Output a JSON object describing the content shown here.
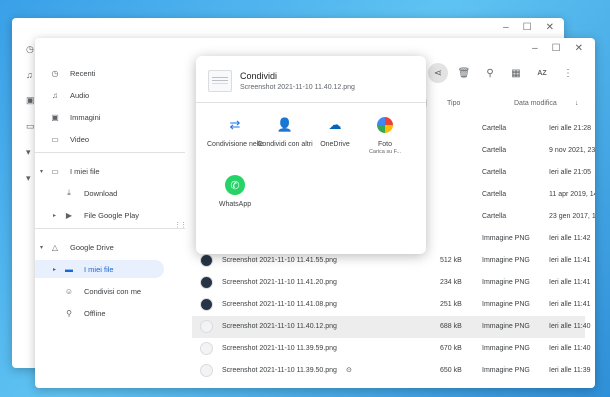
{
  "window_controls": {
    "minimize": "–",
    "maximize": "☐",
    "close": "✕"
  },
  "sidebar": {
    "items": [
      {
        "label": "Recenti",
        "icon": "clock-icon"
      },
      {
        "label": "Audio",
        "icon": "headphones-icon"
      },
      {
        "label": "Immagini",
        "icon": "image-icon"
      },
      {
        "label": "Video",
        "icon": "video-icon"
      },
      {
        "label": "I miei file",
        "icon": "laptop-icon"
      },
      {
        "label": "Download",
        "icon": "download-icon"
      },
      {
        "label": "File Google Play",
        "icon": "play-icon"
      },
      {
        "label": "Google Drive",
        "icon": "drive-icon"
      },
      {
        "label": "I miei file",
        "icon": "folder-icon"
      },
      {
        "label": "Condivisi con me",
        "icon": "people-icon"
      },
      {
        "label": "Offline",
        "icon": "pin-icon"
      }
    ]
  },
  "toolbar": {
    "sort_label": "AZ"
  },
  "columns": {
    "type": "Tipo",
    "date": "Data modifica"
  },
  "share_dialog": {
    "title": "Condividi",
    "file_name": "Screenshot 2021-11-10 11.40.12.png",
    "targets": [
      {
        "label": "Condivisione nelle ...",
        "sub": "",
        "icon": "nearby-share-icon"
      },
      {
        "label": "Condividi con altri",
        "sub": "",
        "icon": "add-person-icon"
      },
      {
        "label": "OneDrive",
        "sub": "",
        "icon": "cloud-icon"
      },
      {
        "label": "Foto",
        "sub": "Carica su F...",
        "icon": "photos-icon"
      },
      {
        "label": "WhatsApp",
        "sub": "",
        "icon": "whatsapp-icon"
      }
    ]
  },
  "files": [
    {
      "name": "",
      "size": "",
      "type": "Cartella",
      "date": "Ieri alle 21:28"
    },
    {
      "name": "",
      "size": "",
      "type": "Cartella",
      "date": "9 nov 2021, 23:08"
    },
    {
      "name": "",
      "size": "",
      "type": "Cartella",
      "date": "Ieri alle 21:05"
    },
    {
      "name": "",
      "size": "",
      "type": "Cartella",
      "date": "11 apr 2019, 14:57"
    },
    {
      "name": "",
      "size": "",
      "type": "Cartella",
      "date": "23 gen 2017, 18:57"
    },
    {
      "name": "",
      "size": "",
      "type": "Immagine PNG",
      "date": "Ieri alle 11:42"
    },
    {
      "name": "Screenshot 2021-11-10 11.41.55.png",
      "size": "512 kB",
      "type": "Immagine PNG",
      "date": "Ieri alle 11:41"
    },
    {
      "name": "Screenshot 2021-11-10 11.41.20.png",
      "size": "234 kB",
      "type": "Immagine PNG",
      "date": "Ieri alle 11:41"
    },
    {
      "name": "Screenshot 2021-11-10 11.41.08.png",
      "size": "251 kB",
      "type": "Immagine PNG",
      "date": "Ieri alle 11:41"
    },
    {
      "name": "Screenshot 2021-11-10 11.40.12.png",
      "size": "688 kB",
      "type": "Immagine PNG",
      "date": "Ieri alle 11:40"
    },
    {
      "name": "Screenshot 2021-11-10 11.39.59.png",
      "size": "670 kB",
      "type": "Immagine PNG",
      "date": "Ieri alle 11:40"
    },
    {
      "name": "Screenshot 2021-11-10 11.39.50.png",
      "size": "650 kB",
      "type": "Immagine PNG",
      "date": "Ieri alle 11:39"
    }
  ]
}
